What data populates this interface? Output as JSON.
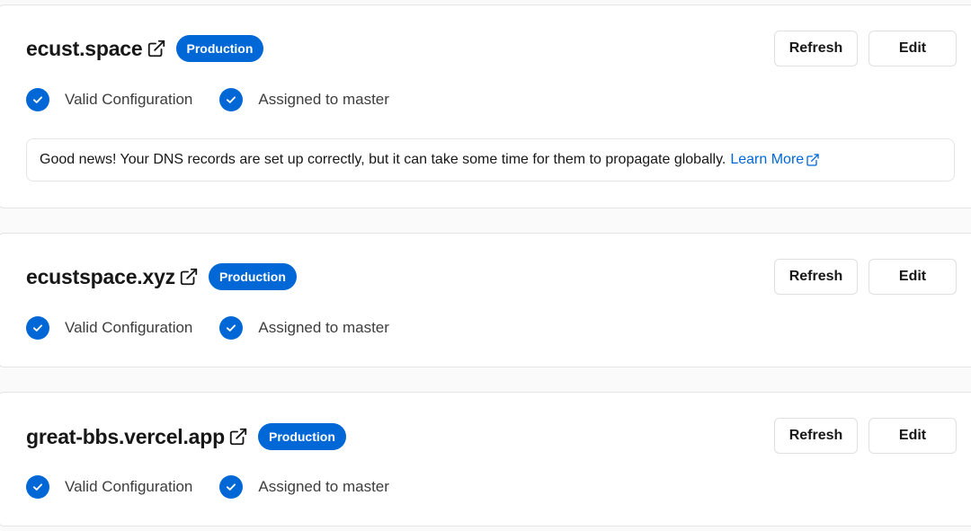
{
  "colors": {
    "accent": "#0068d6",
    "border": "#e5e5e5",
    "text": "#171717",
    "muted_text": "#3d3d3d"
  },
  "domains": [
    {
      "name": "ecust.space",
      "badge": "Production",
      "refresh_label": "Refresh",
      "edit_label": "Edit",
      "status": [
        {
          "label": "Valid Configuration",
          "icon": "check-circle-icon"
        },
        {
          "label": "Assigned to master",
          "icon": "check-circle-icon"
        }
      ],
      "notice": {
        "text": "Good news! Your DNS records are set up correctly, but it can take some time for them to propagate globally.",
        "link_label": "Learn More"
      }
    },
    {
      "name": "ecustspace.xyz",
      "badge": "Production",
      "refresh_label": "Refresh",
      "edit_label": "Edit",
      "status": [
        {
          "label": "Valid Configuration",
          "icon": "check-circle-icon"
        },
        {
          "label": "Assigned to master",
          "icon": "check-circle-icon"
        }
      ]
    },
    {
      "name": "great-bbs.vercel.app",
      "badge": "Production",
      "refresh_label": "Refresh",
      "edit_label": "Edit",
      "status": [
        {
          "label": "Valid Configuration",
          "icon": "check-circle-icon"
        },
        {
          "label": "Assigned to master",
          "icon": "check-circle-icon"
        }
      ]
    }
  ]
}
